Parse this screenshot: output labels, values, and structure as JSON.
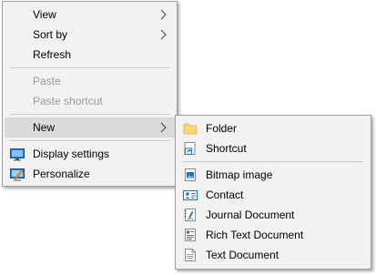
{
  "main_menu": {
    "items": [
      {
        "label": "View"
      },
      {
        "label": "Sort by"
      },
      {
        "label": "Refresh"
      },
      {
        "label": "Paste"
      },
      {
        "label": "Paste shortcut"
      },
      {
        "label": "New"
      },
      {
        "label": "Display settings"
      },
      {
        "label": "Personalize"
      }
    ]
  },
  "new_submenu": {
    "items": [
      {
        "label": "Folder"
      },
      {
        "label": "Shortcut"
      },
      {
        "label": "Bitmap image"
      },
      {
        "label": "Contact"
      },
      {
        "label": "Journal Document"
      },
      {
        "label": "Rich Text Document"
      },
      {
        "label": "Text Document"
      }
    ]
  },
  "icons": {
    "display_settings": "display-settings-icon",
    "personalize": "personalize-icon",
    "folder": "folder-icon",
    "shortcut": "shortcut-icon",
    "bitmap": "bitmap-image-icon",
    "contact": "contact-card-icon",
    "journal": "journal-document-icon",
    "rich_text": "rich-text-document-icon",
    "text": "text-document-icon"
  },
  "colors": {
    "menu_background": "#f2f2f2",
    "highlight": "#dadada",
    "disabled_text": "#9a9a9a",
    "folder": "#f8d775",
    "accent_blue": "#1e73c8"
  }
}
